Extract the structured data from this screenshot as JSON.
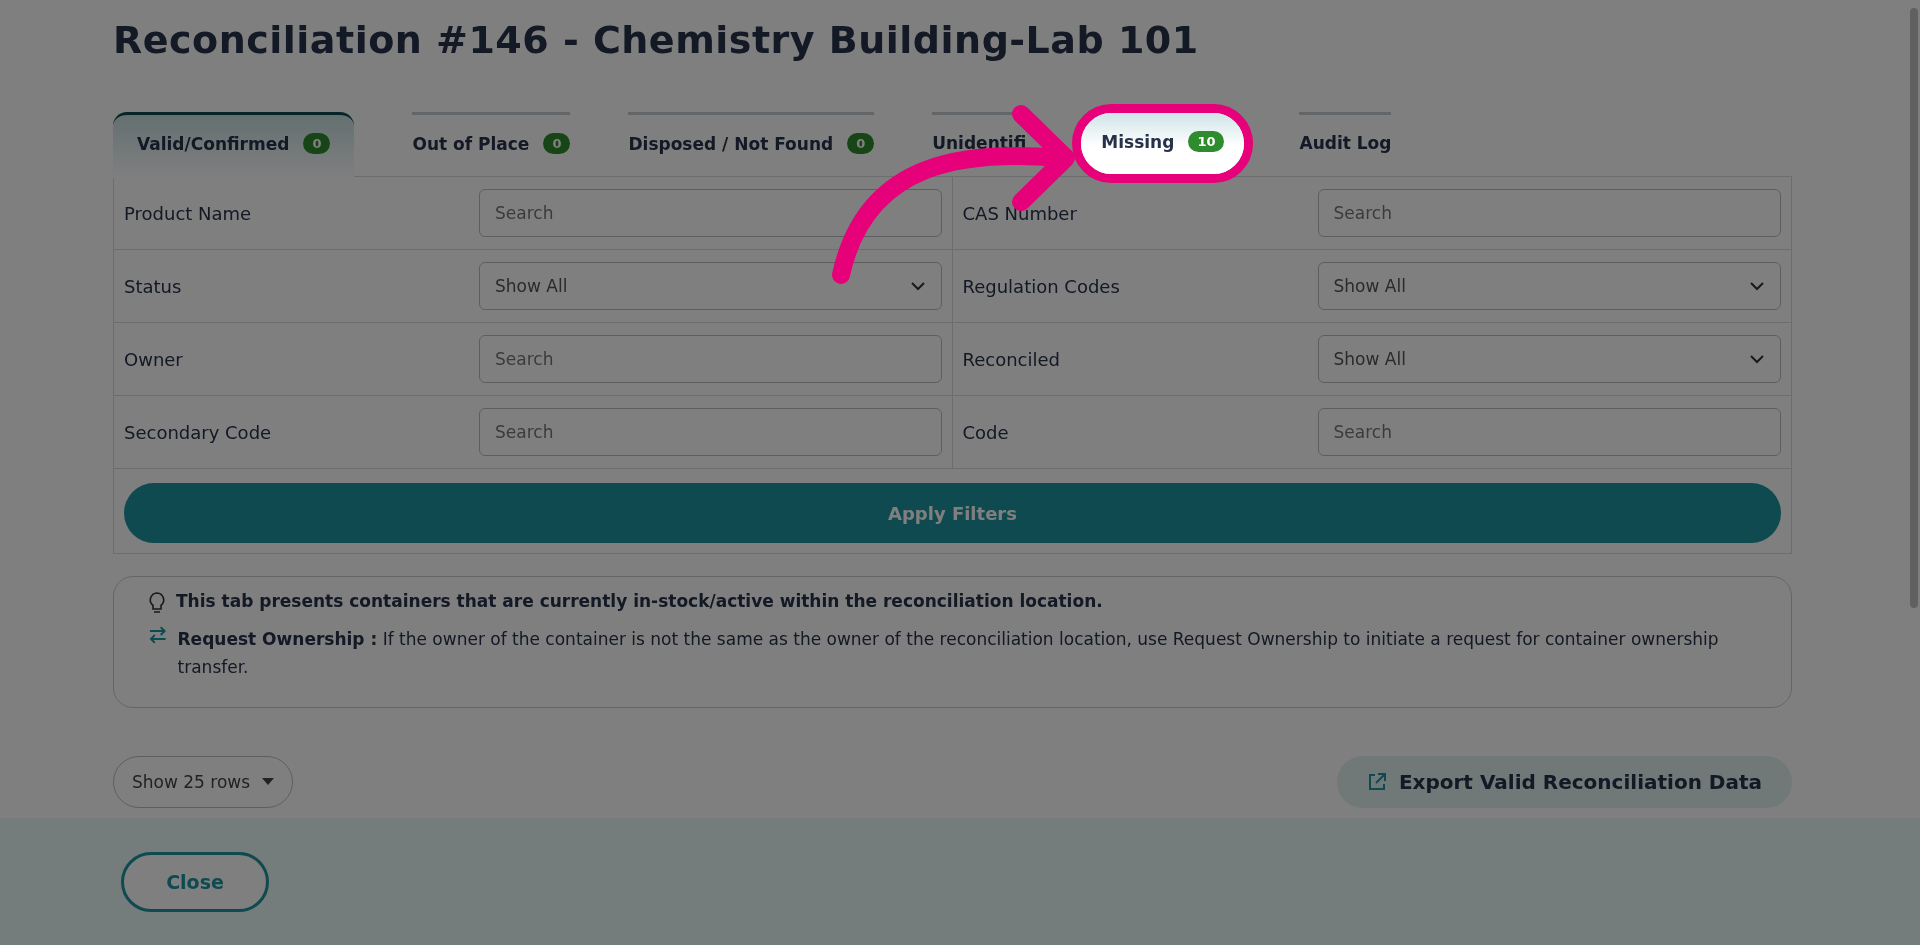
{
  "title": "Reconciliation #146 - Chemistry Building-Lab 101",
  "tabs": [
    {
      "label": "Valid/Confirmed",
      "badge": "0",
      "selected": true,
      "highlighted": false
    },
    {
      "label": "Out of Place",
      "badge": "0",
      "selected": false,
      "highlighted": false
    },
    {
      "label": "Disposed / Not Found",
      "badge": "0",
      "selected": false,
      "highlighted": false
    },
    {
      "label": "Unidentifi",
      "selected": false,
      "highlighted": false
    },
    {
      "label": "Missing",
      "badge": "10",
      "selected": false,
      "highlighted": true
    },
    {
      "label": "Audit Log",
      "selected": false,
      "highlighted": false
    }
  ],
  "filters": [
    {
      "label": "Product Name",
      "kind": "text",
      "placeholder": "Search"
    },
    {
      "label": "CAS Number",
      "kind": "text",
      "placeholder": "Search"
    },
    {
      "label": "Status",
      "kind": "select",
      "value": "Show All"
    },
    {
      "label": "Regulation Codes",
      "kind": "select",
      "value": "Show All"
    },
    {
      "label": "Owner",
      "kind": "text",
      "placeholder": "Search"
    },
    {
      "label": "Reconciled",
      "kind": "select",
      "value": "Show All"
    },
    {
      "label": "Secondary Code",
      "kind": "text",
      "placeholder": "Search"
    },
    {
      "label": "Code",
      "kind": "text",
      "placeholder": "Search"
    }
  ],
  "apply_button": "Apply Filters",
  "info": {
    "note": "This tab presents containers that are currently in-stock/active within the reconciliation location.",
    "request": "**Request Ownership :** If the owner of the container is not the same as the owner of the reconciliation location, use Request Ownership to initiate a request for container ownership transfer."
  },
  "rows_select": "Show 25 rows",
  "export_button": "Export Valid Reconciliation Data",
  "close_button": "Close"
}
